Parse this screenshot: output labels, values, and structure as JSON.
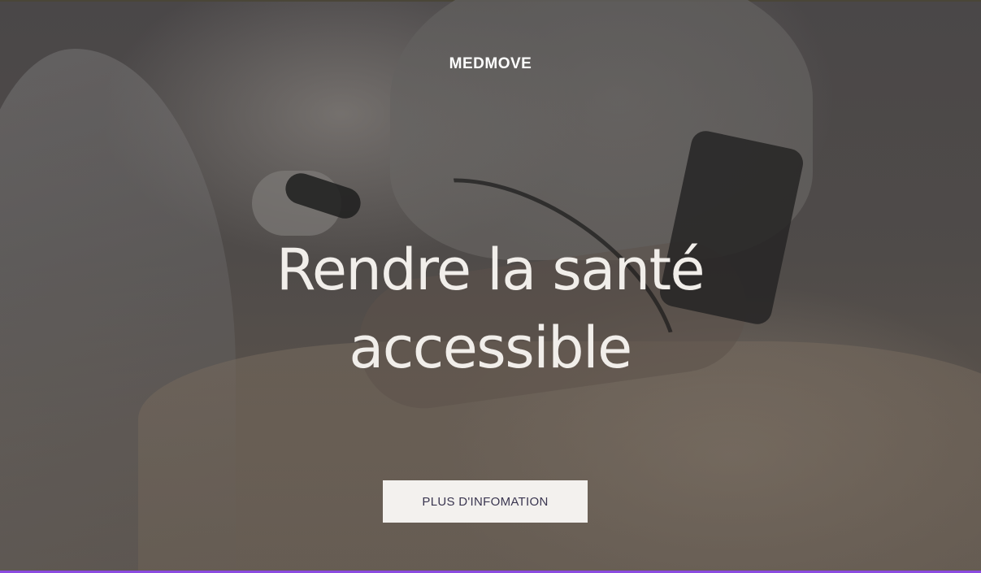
{
  "hero": {
    "brand": "MEDMOVE",
    "headline_line1": "Rendre la santé",
    "headline_line2": "accessible",
    "cta_label": "PLUS D'INFOMATION"
  },
  "colors": {
    "overlay": "#4a4748",
    "headline": "#f1eeea",
    "button_bg": "#f3f1ee",
    "button_text": "#3a3650",
    "accent_bottom": "#8b4be0"
  }
}
